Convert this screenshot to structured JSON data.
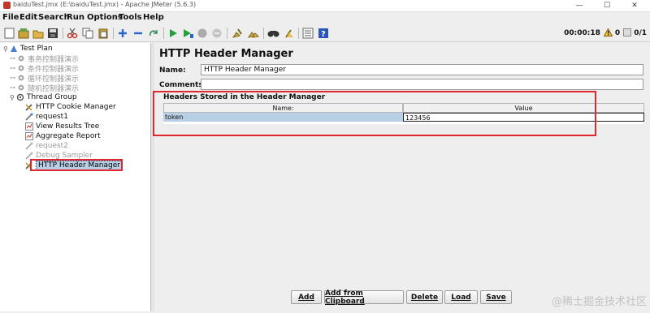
{
  "window": {
    "title": "baiduTest.jmx (E:\\baiduTest.jmx) - Apache JMeter (5.6.3)",
    "controls": {
      "minimize": "—",
      "maximize": "☐",
      "close": "✕"
    }
  },
  "menu": [
    "File",
    "Edit",
    "Search",
    "Run",
    "Options",
    "Tools",
    "Help"
  ],
  "toolbar": {
    "buttons": [
      "new-icon",
      "templates-icon",
      "open-icon",
      "save-icon",
      "cut-icon",
      "copy-icon",
      "paste-icon",
      "expand-icon",
      "collapse-icon",
      "toggle-icon",
      "start-icon",
      "start-no-pause-icon",
      "stop-icon",
      "shutdown-icon",
      "clear-icon",
      "clear-all-icon",
      "search-icon",
      "reset-search-icon",
      "function-helper-icon",
      "help-icon"
    ],
    "elapsed": "00:00:18",
    "warnings": "0",
    "threads": "0/1"
  },
  "tree": {
    "items": [
      {
        "label": "Test Plan",
        "icon": "test-plan-icon",
        "disabled": false
      },
      {
        "label": "事务控制器演示",
        "icon": "gear-icon",
        "disabled": true
      },
      {
        "label": "条件控制器演示",
        "icon": "gear-icon",
        "disabled": true
      },
      {
        "label": "循环控制器演示",
        "icon": "gear-icon",
        "disabled": true
      },
      {
        "label": "随机控制器演示",
        "icon": "gear-icon",
        "disabled": true
      },
      {
        "label": "Thread Group",
        "icon": "gear-icon",
        "disabled": false
      },
      {
        "label": "HTTP Cookie Manager",
        "icon": "wrench-icon",
        "disabled": false
      },
      {
        "label": "request1",
        "icon": "pipette-icon",
        "disabled": false
      },
      {
        "label": "View Results Tree",
        "icon": "chart-icon",
        "disabled": false
      },
      {
        "label": "Aggregate Report",
        "icon": "chart-icon",
        "disabled": false
      },
      {
        "label": "request2",
        "icon": "pipette-icon",
        "disabled": true
      },
      {
        "label": "Debug Sampler",
        "icon": "pipette-icon",
        "disabled": true
      },
      {
        "label": "HTTP Header Manager",
        "icon": "wrench-icon",
        "disabled": false,
        "selected": true
      }
    ]
  },
  "panel": {
    "title": "HTTP Header Manager",
    "name_label": "Name:",
    "name_value": "HTTP Header Manager",
    "comments_label": "Comments:",
    "comments_value": ""
  },
  "headers": {
    "title": "Headers Stored in the Header Manager",
    "columns": [
      "Name:",
      "Value"
    ],
    "rows": [
      {
        "name": "token",
        "value": "123456"
      }
    ]
  },
  "buttons": {
    "add": "Add",
    "add_clipboard": "Add from Clipboard",
    "delete": "Delete",
    "load": "Load",
    "save": "Save"
  },
  "watermark": "@稀土掘金技术社区",
  "colors": {
    "annotation": "#e0262f",
    "selection": "#b8cfe5"
  }
}
